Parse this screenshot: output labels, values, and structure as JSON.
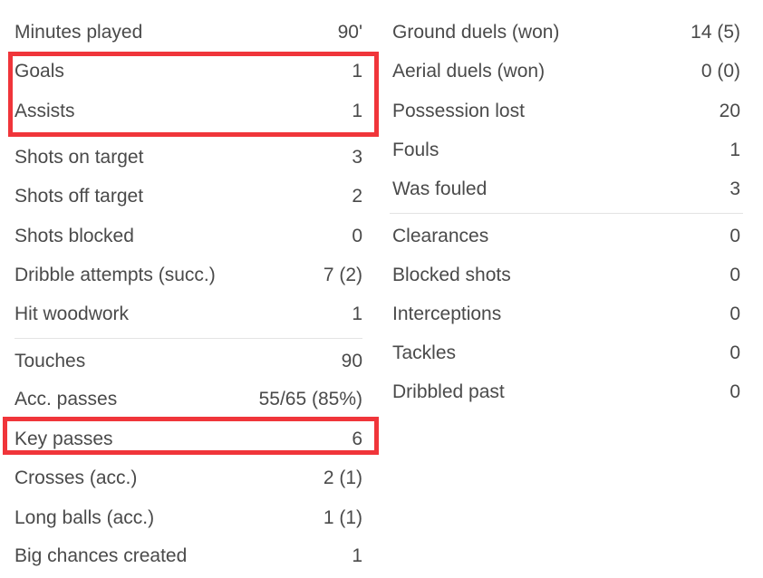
{
  "left_column": [
    {
      "label": "Minutes played",
      "value": "90'"
    },
    {
      "label": "Goals",
      "value": "1"
    },
    {
      "label": "Assists",
      "value": "1"
    },
    {
      "label": "Shots on target",
      "value": "3"
    },
    {
      "label": "Shots off target",
      "value": "2"
    },
    {
      "label": "Shots blocked",
      "value": "0"
    },
    {
      "label": "Dribble attempts (succ.)",
      "value": "7 (2)"
    },
    {
      "label": "Hit woodwork",
      "value": "1"
    },
    {
      "label": "Touches",
      "value": "90"
    },
    {
      "label": "Acc. passes",
      "value": "55/65 (85%)"
    },
    {
      "label": "Key passes",
      "value": "6"
    },
    {
      "label": "Crosses (acc.)",
      "value": "2 (1)"
    },
    {
      "label": "Long balls (acc.)",
      "value": "1 (1)"
    },
    {
      "label": "Big chances created",
      "value": "1"
    }
  ],
  "right_column": [
    {
      "label": "Ground duels (won)",
      "value": "14 (5)"
    },
    {
      "label": "Aerial duels (won)",
      "value": "0 (0)"
    },
    {
      "label": "Possession lost",
      "value": "20"
    },
    {
      "label": "Fouls",
      "value": "1"
    },
    {
      "label": "Was fouled",
      "value": "3"
    },
    {
      "label": "Clearances",
      "value": "0"
    },
    {
      "label": "Blocked shots",
      "value": "0"
    },
    {
      "label": "Interceptions",
      "value": "0"
    },
    {
      "label": "Tackles",
      "value": "0"
    },
    {
      "label": "Dribbled past",
      "value": "0"
    }
  ],
  "highlight_color": "#f0353a"
}
